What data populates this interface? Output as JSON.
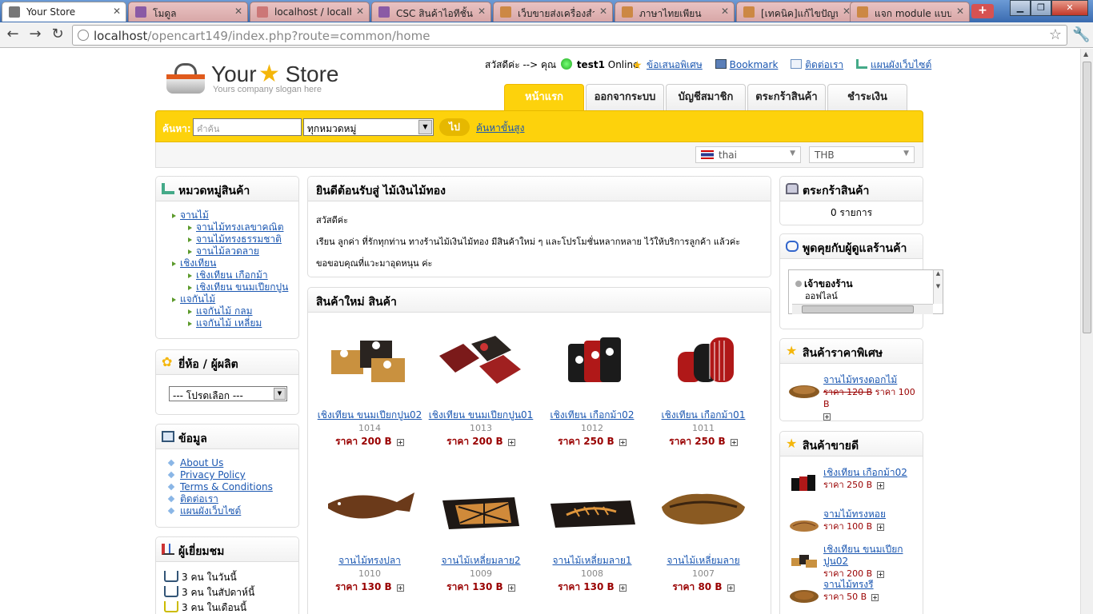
{
  "browser": {
    "tabs": [
      {
        "title": "Your Store",
        "active": true
      },
      {
        "title": "โมดูล"
      },
      {
        "title": "localhost / localhos"
      },
      {
        "title": "CSC สินค้าไอทีชั้นนำ"
      },
      {
        "title": "เว็บขายส่งเครื่องสำอา"
      },
      {
        "title": "ภาษาไทยเพียน"
      },
      {
        "title": "[เทคนิค]แก้ไขปัญหา"
      },
      {
        "title": "แจก module แบบไม่"
      }
    ],
    "url_host": "localhost",
    "url_path": "/opencart149/index.php?route=common/home"
  },
  "header": {
    "logo_your": "Your",
    "logo_store": "Store",
    "slogan": "Yours company slogan here",
    "greeting": "สวัสดีค่ะ --> คุณ",
    "username": "test1",
    "status": "Online",
    "links": [
      "ข้อเสนอพิเศษ",
      "Bookmark",
      "ติดต่อเรา",
      "แผนผังเว็บไซต์"
    ]
  },
  "tabs": [
    "หน้าแรก",
    "ออกจากระบบ",
    "บัญชีสมาชิก",
    "ตระกร้าสินค้า",
    "ชำระเงิน"
  ],
  "search": {
    "label": "ค้นหา:",
    "placeholder": "คำค้น",
    "category": "ทุกหมวดหมู่",
    "go": "ไป",
    "advanced": "ค้นหาขั้นสูง"
  },
  "language": "thai",
  "currency": "THB",
  "left": {
    "categories_title": "หมวดหมู่สินค้า",
    "categories": [
      {
        "label": "จานไม้",
        "level": 0
      },
      {
        "label": "จานไม้ทรงเลขาคณิต",
        "level": 1
      },
      {
        "label": "จานไม้ทรงธรรมชาติ",
        "level": 1
      },
      {
        "label": "จานไม้ลวดลาย",
        "level": 1
      },
      {
        "label": "เชิงเทียน",
        "level": 0
      },
      {
        "label": "เชิงเทียน เกือกม้า",
        "level": 1
      },
      {
        "label": "เชิงเทียน ขนมเปียกปูน",
        "level": 1
      },
      {
        "label": "แจกันไม้",
        "level": 0
      },
      {
        "label": "แจกันไม้ กลม",
        "level": 1
      },
      {
        "label": "แจกันไม้ เหลี่ยม",
        "level": 1
      }
    ],
    "brand_title": "ยี่ห้อ / ผู้ผลิต",
    "brand_select": "--- โปรดเลือก ---",
    "info_title": "ข้อมูล",
    "info": [
      "About Us",
      "Privacy Policy",
      "Terms & Conditions",
      "ติดต่อเรา",
      "แผนผังเว็บไซต์"
    ],
    "visitors_title": "ผู้เยี่ยมชม",
    "visitors": [
      "3 คน ในวันนี้",
      "3 คน ในสัปดาห์นี้",
      "3 คน ในเดือนนี้"
    ]
  },
  "welcome": {
    "title": "ยินดีต้อนรับสู่ ไม้เงินไม้ทอง",
    "line1": "สวัสดีค่ะ",
    "line2": "เรียน ลูกค่า ที่รักทุกท่าน ทางร้านไม้เงินไม้ทอง มีสินค้าใหม่ ๆ และโปรโมชั่นหลากหลาย ไว้ให้บริการลูกค้า แล้วค่ะ",
    "line3": "ขอขอบคุณที่แวะมาอุดหนุน ค่ะ"
  },
  "latest": {
    "title": "สินค้าใหม่ สินค้า",
    "products": [
      {
        "name": "เชิงเทียน ขนมเปียกปูน02",
        "model": "1014",
        "price": "ราคา 200 B"
      },
      {
        "name": "เชิงเทียน ขนมเปียกปูน01",
        "model": "1013",
        "price": "ราคา 200 B"
      },
      {
        "name": "เชิงเทียน เกือกม้า02",
        "model": "1012",
        "price": "ราคา 250 B"
      },
      {
        "name": "เชิงเทียน เกือกม้า01",
        "model": "1011",
        "price": "ราคา 250 B"
      },
      {
        "name": "จานไม้ทรงปลา",
        "model": "1010",
        "price": "ราคา 130 B"
      },
      {
        "name": "จานไม้เหลี่ยมลาย2",
        "model": "1009",
        "price": "ราคา 130 B"
      },
      {
        "name": "จานไม้เหลี่ยมลาย1",
        "model": "1008",
        "price": "ราคา 130 B"
      },
      {
        "name": "จานไม้เหลี่ยมลาย",
        "model": "1007",
        "price": "ราคา 80 B"
      }
    ]
  },
  "right": {
    "cart_title": "ตระกร้าสินค้า",
    "cart_items": "0 รายการ",
    "chat_title": "พูดคุยกับผู้ดูแลร้านค้า",
    "chat_name": "เจ้าของร้าน",
    "chat_status": "ออฟไลน์",
    "specials_title": "สินค้าราคาพิเศษ",
    "special": {
      "name": "จานไม้ทรงดอกไม้",
      "old": "ราคา 120 B",
      "new": "ราคา 100 B"
    },
    "best_title": "สินค้าขายดี",
    "best": [
      {
        "name": "เชิงเทียน เกือกม้า02",
        "price": "ราคา 250 B"
      },
      {
        "name": "จามไม้ทรงหอย",
        "price": "ราคา 100 B"
      },
      {
        "name": "เชิงเทียน ขนมเปียกปูน02",
        "price": "ราคา 200 B"
      },
      {
        "name": "จานไม้ทรงรี",
        "price": "ราคา 50 B"
      }
    ]
  }
}
